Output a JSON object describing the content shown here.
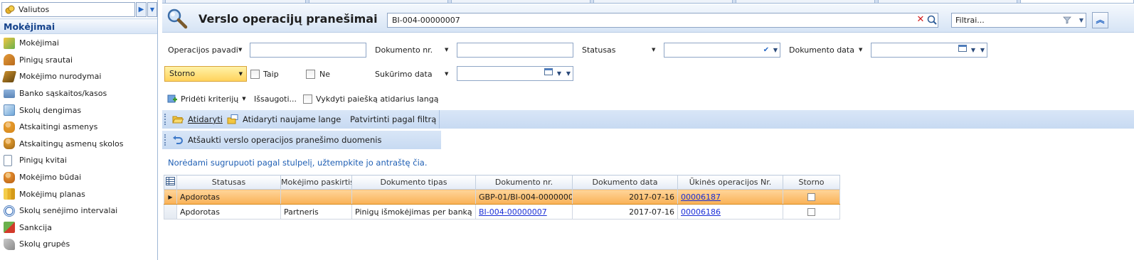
{
  "colors": {
    "accent": "#15428b",
    "link": "#1a2fd6",
    "selection": "#f9b156",
    "hint": "#1f5fb4",
    "clear": "#d21c1c"
  },
  "sidebar": {
    "combo_value": "Valiutos",
    "header": "Mokėjimai",
    "items": [
      {
        "label": "Mokėjimai",
        "icon": "payments-icon"
      },
      {
        "label": "Pinigų srautai",
        "icon": "cash-flow-icon"
      },
      {
        "label": "Mokėjimo nurodymai",
        "icon": "payment-order-icon"
      },
      {
        "label": "Banko sąskaitos/kasos",
        "icon": "bank-account-icon"
      },
      {
        "label": "Skolų dengimas",
        "icon": "debt-covering-icon"
      },
      {
        "label": "Atskaitingi asmenys",
        "icon": "accountable-persons-icon"
      },
      {
        "label": "Atskaitingų asmenų skolos",
        "icon": "accountable-debts-icon"
      },
      {
        "label": "Pinigų kvitai",
        "icon": "cash-receipt-icon"
      },
      {
        "label": "Mokėjimo būdai",
        "icon": "payment-methods-icon"
      },
      {
        "label": "Mokėjimų planas",
        "icon": "payment-plan-icon"
      },
      {
        "label": "Skolų senėjimo intervalai",
        "icon": "debt-aging-icon"
      },
      {
        "label": "Sankcija",
        "icon": "sanction-icon"
      },
      {
        "label": "Skolų grupės",
        "icon": "debt-groups-icon"
      }
    ]
  },
  "header": {
    "title": "Verslo operacijų pranešimai",
    "search_value": "BI-004-00000007",
    "filters_placeholder": "Filtrai..."
  },
  "criteria": {
    "operation_name_label": "Operacijos pavadi",
    "doc_no_label": "Dokumento nr.",
    "status_label": "Statusas",
    "doc_date_label": "Dokumento data",
    "storno_value": "Storno",
    "yes_label": "Taip",
    "no_label": "Ne",
    "created_date_label": "Sukūrimo data",
    "add_criteria_label": "Pridėti kriterijų",
    "save_label": "Išsaugoti...",
    "search_on_open_label": "Vykdyti paiešką atidarius langą"
  },
  "toolbar": {
    "open_label": "Atidaryti",
    "open_new_window_label": "Atidaryti naujame lange",
    "confirm_by_filter_label": "Patvirtinti pagal filtrą",
    "revoke_label": "Atšaukti verslo operacijos pranešimo duomenis"
  },
  "group_hint": "Norėdami sugrupuoti pagal stulpelį, užtempkite jo antraštę čia.",
  "grid": {
    "columns": [
      "Statusas",
      "Mokėjimo paskirtis",
      "Dokumento tipas",
      "Dokumento nr.",
      "Dokumento data",
      "Ūkinės operacijos Nr.",
      "Storno"
    ],
    "rows": [
      {
        "status": "Apdorotas",
        "purpose": "",
        "doc_type": "",
        "doc_no": "GBP-01/BI-004-00000007",
        "doc_date": "2017-07-16",
        "op_no": "00006187",
        "storno": false
      },
      {
        "status": "Apdorotas",
        "purpose": "Partneris",
        "doc_type": "Pinigų išmokėjimas per banką",
        "doc_no": "BI-004-00000007",
        "doc_date": "2017-07-16",
        "op_no": "00006186",
        "storno": false
      }
    ]
  }
}
